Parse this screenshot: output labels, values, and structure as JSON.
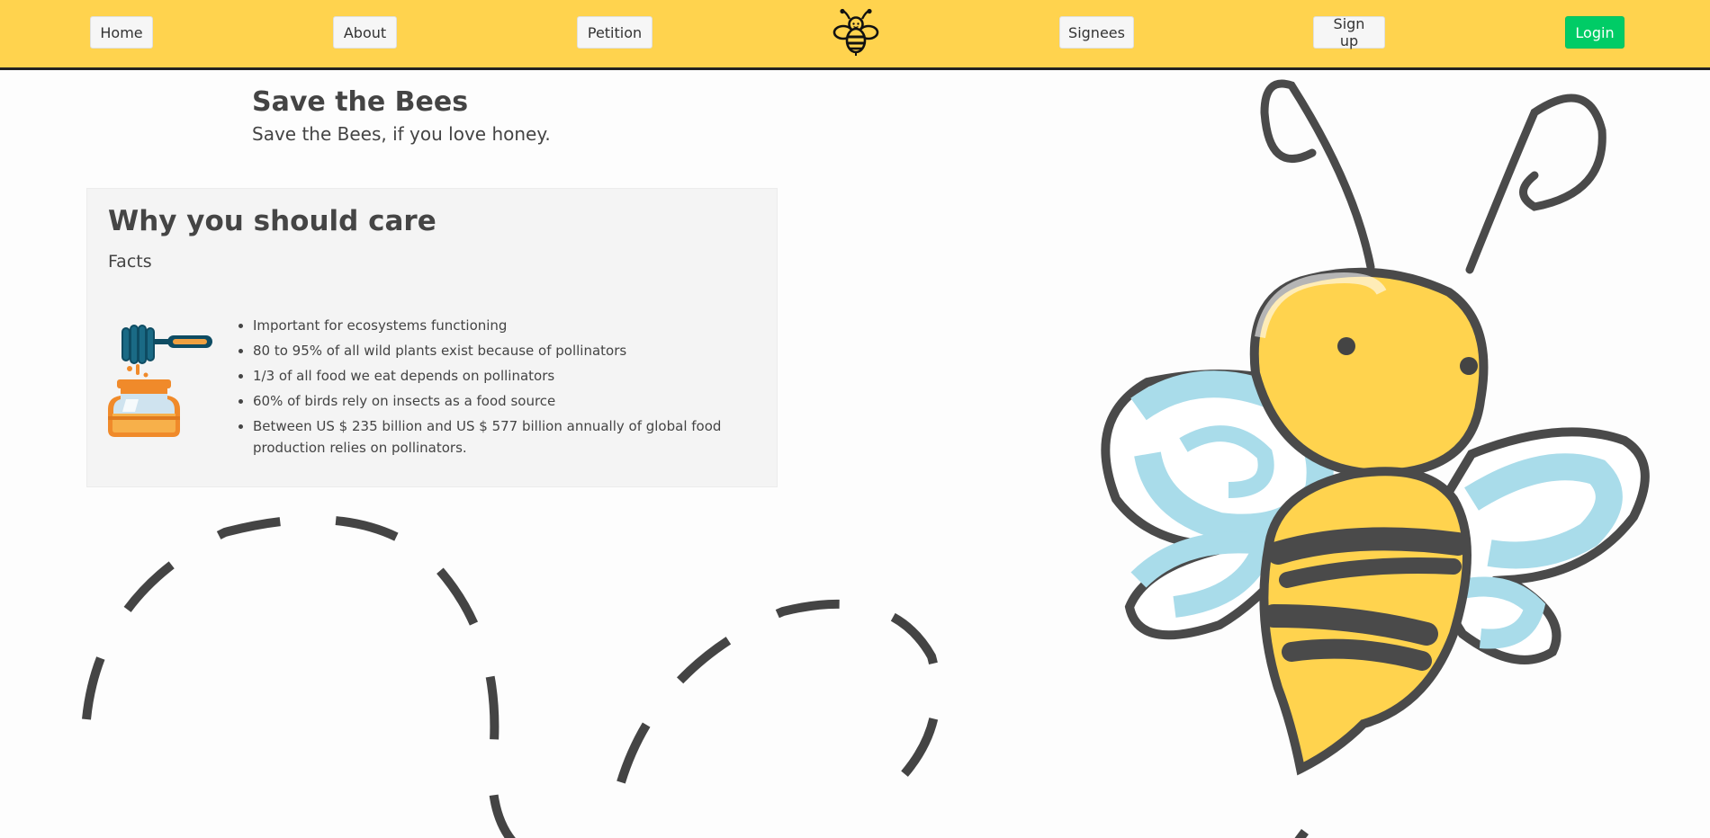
{
  "nav": {
    "items": [
      "Home",
      "About",
      "Petition",
      "Signees",
      "Sign up"
    ],
    "login": "Login"
  },
  "header": {
    "title": "Save the Bees",
    "subtitle": "Save the Bees, if you love honey."
  },
  "card": {
    "title": "Why you should care",
    "subtitle": "Facts",
    "facts": [
      "Important for ecosystems functioning",
      "80 to 95% of all wild plants exist because of pollinators",
      "1/3 of all food we eat depends on pollinators",
      "60% of birds rely on insects as a food source",
      "Between US $ 235 billion and US $ 577 billion annually of global food production relies on pollinators."
    ]
  },
  "icons": {
    "logo": "bee-logo-icon",
    "honey": "honey-jar-icon",
    "illustration": "bee-illustration"
  },
  "colors": {
    "navbar": "#ffd34e",
    "login": "#00cc66",
    "card": "#f4f4f4",
    "wing": "#a9dcea",
    "text": "#444444"
  }
}
